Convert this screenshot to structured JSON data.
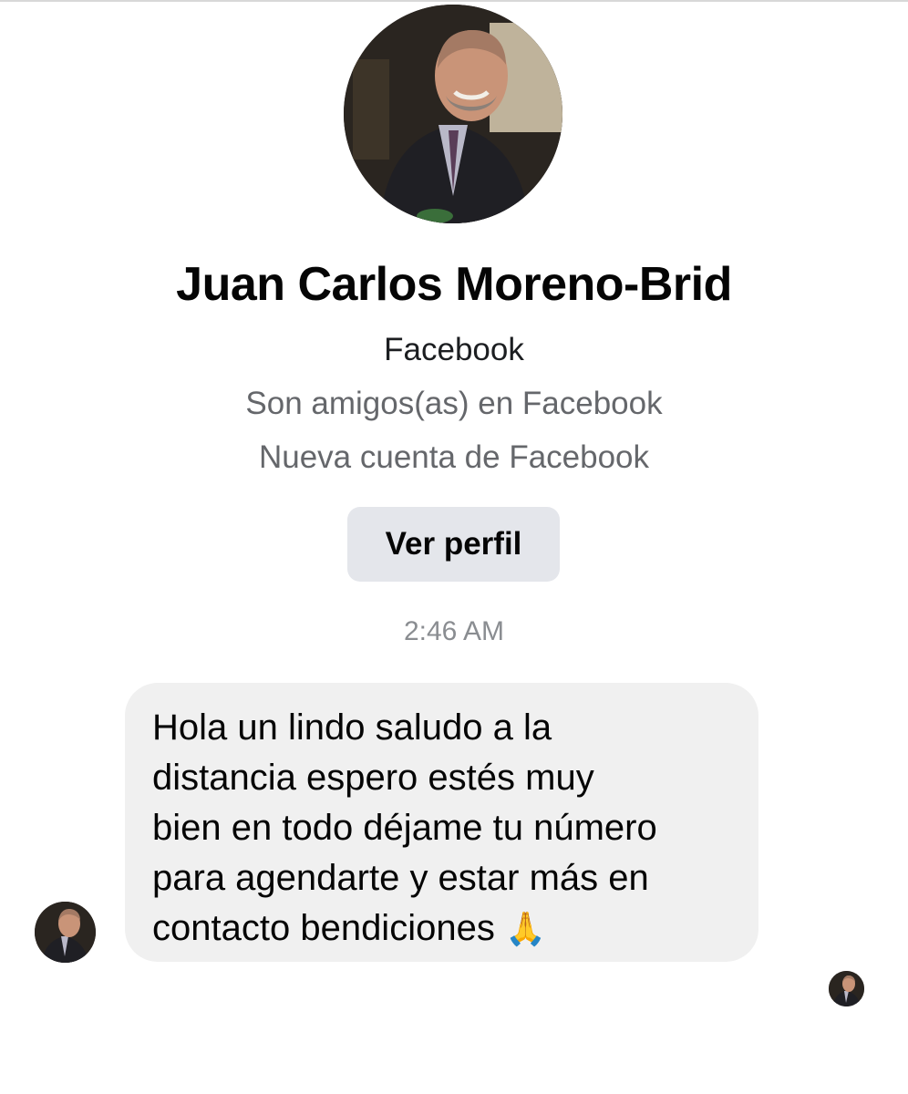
{
  "profile": {
    "name": "Juan Carlos Moreno-Brid",
    "platform": "Facebook",
    "friendship_status": "Son amigos(as) en Facebook",
    "account_status": "Nueva cuenta de Facebook",
    "view_profile_label": "Ver perfil",
    "photo_icon": "profile-photo"
  },
  "conversation": {
    "timestamp": "2:46 AM",
    "messages": [
      {
        "sender": "incoming",
        "lines": [
          "Hola un lindo saludo a la",
          "distancia espero estés muy",
          "bien en todo déjame tu número",
          "para agendarte y estar más en",
          "contacto bendiciones"
        ],
        "emoji": "🙏"
      }
    ]
  },
  "colors": {
    "bubble_background": "#f0f0f0",
    "button_background": "#e4e6eb",
    "secondary_text": "#65676b",
    "timestamp_text": "#8a8d91"
  }
}
